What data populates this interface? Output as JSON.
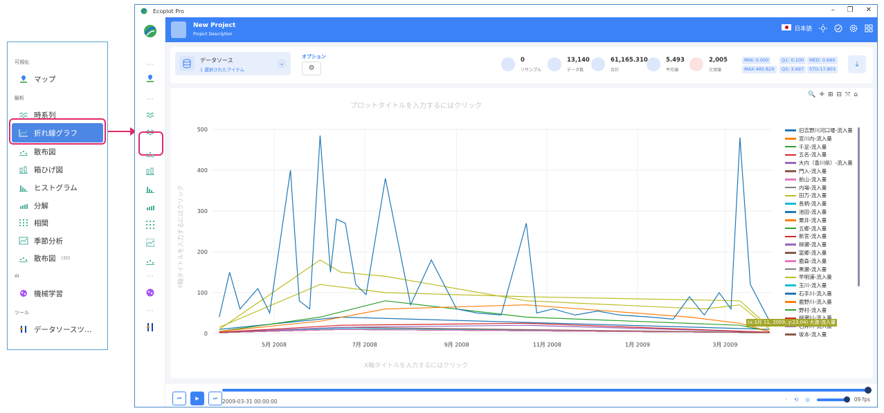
{
  "annotation_panel": {
    "sections": [
      {
        "label": "可視化",
        "items": [
          {
            "label": "マップ",
            "icon": "map-pin-icon"
          }
        ]
      },
      {
        "label": "解析",
        "items": [
          {
            "label": "時系列",
            "icon": "timeseries-icon"
          },
          {
            "label": "折れ線グラフ",
            "icon": "line-chart-icon",
            "selected": true
          },
          {
            "label": "散布図",
            "icon": "scatter-icon"
          },
          {
            "label": "箱ひげ図",
            "icon": "boxplot-icon"
          },
          {
            "label": "ヒストグラム",
            "icon": "histogram-icon"
          },
          {
            "label": "分解",
            "icon": "decompose-icon"
          },
          {
            "label": "相関",
            "icon": "correlation-icon"
          },
          {
            "label": "季節分析",
            "icon": "seasonal-icon"
          },
          {
            "label": "散布図",
            "icon": "scatter3d-icon",
            "sub": "(3D)"
          }
        ]
      },
      {
        "label": "AI",
        "items": [
          {
            "label": "機械学習",
            "icon": "ml-icon"
          }
        ]
      },
      {
        "label": "ツール",
        "items": [
          {
            "label": "データソースツ…",
            "icon": "tools-icon"
          }
        ]
      }
    ]
  },
  "window": {
    "title": "Ecoplot Pro",
    "controls": [
      "–",
      "❐",
      "✕"
    ]
  },
  "header": {
    "project_name": "New Project",
    "project_desc": "Project Description",
    "language": "日本語"
  },
  "toolbar": {
    "datasource_title": "データソース",
    "datasource_sub": "1 選択されたアイテム",
    "options_label": "オプション",
    "stats": [
      {
        "value": "0",
        "label": "リサンプル"
      },
      {
        "value": "13,140",
        "label": "データ数"
      },
      {
        "value": "61,165.310",
        "label": "合計"
      },
      {
        "value": "5.493",
        "label": "平均値"
      },
      {
        "value": "2,005",
        "label": "欠測値"
      }
    ],
    "quartiles": {
      "min": "MIN:   0.000",
      "q1": "Q1:  0.100",
      "med": "MED:  0.660",
      "max": "MAX:485.820",
      "q3": "Q3:  3.697",
      "std": "STD:17.803"
    }
  },
  "chart": {
    "plot_title": "プロットタイトルを入力するにはクリック",
    "x_title": "X軸タイトルを入力するにはクリック",
    "y_title": "Y軸タイトルを入力するにはクリック",
    "tooltip": "(x:3月 11, 2009, y:23.04)",
    "tooltip_series": "大渡-流入量"
  },
  "chart_data": {
    "type": "line",
    "xlabel": "",
    "ylabel": "",
    "ylim": [
      0,
      500
    ],
    "yticks": [
      "0",
      "100",
      "200",
      "300",
      "400",
      "500"
    ],
    "xticks": [
      "5月 2008",
      "7月 2008",
      "9月 2008",
      "11月 2008",
      "1月 2009",
      "3月 2009"
    ],
    "xrange": [
      "2008-03-20",
      "2009-04-02"
    ],
    "grid": true,
    "legend_position": "right",
    "series": [
      {
        "name": "旧吉野川河口堰-流入量",
        "color": "#1f77b4",
        "x": [
          "2008-03-25",
          "2008-04-01",
          "2008-04-08",
          "2008-04-20",
          "2008-04-28",
          "2008-05-12",
          "2008-05-18",
          "2008-05-25",
          "2008-06-01",
          "2008-06-08",
          "2008-06-12",
          "2008-06-18",
          "2008-06-25",
          "2008-07-02",
          "2008-07-15",
          "2008-08-01",
          "2008-08-15",
          "2008-09-01",
          "2008-09-15",
          "2008-10-01",
          "2008-10-18",
          "2008-10-25",
          "2008-11-05",
          "2008-11-20",
          "2008-12-05",
          "2008-12-20",
          "2009-01-10",
          "2009-01-25",
          "2009-02-05",
          "2009-02-15",
          "2009-02-25",
          "2009-03-05",
          "2009-03-11",
          "2009-03-18",
          "2009-03-31"
        ],
        "y": [
          40,
          150,
          60,
          110,
          50,
          400,
          80,
          60,
          485,
          150,
          280,
          270,
          120,
          95,
          380,
          70,
          180,
          60,
          50,
          45,
          270,
          50,
          60,
          45,
          55,
          45,
          40,
          35,
          90,
          45,
          100,
          60,
          480,
          120,
          30
        ]
      },
      {
        "name": "宮川内-流入量",
        "color": "#ff7f0e",
        "x": [
          "2008-03-25",
          "2008-06-01",
          "2008-07-15",
          "2008-10-18",
          "2009-02-05",
          "2009-03-11",
          "2009-03-31"
        ],
        "y": [
          5,
          30,
          60,
          70,
          40,
          25,
          5
        ]
      },
      {
        "name": "千足-流入量",
        "color": "#2ca02c",
        "x": [
          "2008-03-25",
          "2008-06-01",
          "2008-07-15",
          "2008-10-18",
          "2009-03-11",
          "2009-03-31"
        ],
        "y": [
          5,
          40,
          80,
          40,
          20,
          5
        ]
      },
      {
        "name": "五名-流入量",
        "color": "#d62728",
        "x": [
          "2008-03-25",
          "2008-06-15",
          "2008-10-18",
          "2009-03-31"
        ],
        "y": [
          3,
          20,
          25,
          3
        ]
      },
      {
        "name": "大内（香川県）-流入量",
        "color": "#9467bd",
        "x": [
          "2008-03-25",
          "2008-06-15",
          "2008-10-18",
          "2009-03-31"
        ],
        "y": [
          3,
          15,
          20,
          3
        ]
      },
      {
        "name": "門入-流入量",
        "color": "#8c564b",
        "x": [
          "2008-03-25",
          "2008-06-15",
          "2009-03-31"
        ],
        "y": [
          2,
          15,
          2
        ]
      },
      {
        "name": "前山-流入量",
        "color": "#e377c2",
        "x": [
          "2008-03-25",
          "2008-06-15",
          "2009-03-31"
        ],
        "y": [
          2,
          10,
          2
        ]
      },
      {
        "name": "内場-流入量",
        "color": "#7f7f7f",
        "x": [
          "2008-03-25",
          "2008-06-15",
          "2009-03-31"
        ],
        "y": [
          2,
          10,
          2
        ]
      },
      {
        "name": "田万-流入量",
        "color": "#bcbd22",
        "x": [
          "2008-03-25",
          "2008-06-01",
          "2008-06-15",
          "2008-07-15",
          "2008-10-18",
          "2009-02-15",
          "2009-03-11",
          "2009-03-31"
        ],
        "y": [
          10,
          180,
          150,
          140,
          80,
          60,
          70,
          10
        ]
      },
      {
        "name": "長柄-流入量",
        "color": "#17becf",
        "x": [
          "2008-03-25",
          "2008-06-15",
          "2009-03-31"
        ],
        "y": [
          2,
          12,
          2
        ]
      },
      {
        "name": "池田-流入量",
        "color": "#1f77b4",
        "x": [
          "2008-03-25",
          "2008-06-15",
          "2009-03-31"
        ],
        "y": [
          10,
          40,
          10
        ]
      },
      {
        "name": "粟井-流入量",
        "color": "#ff7f0e",
        "x": [
          "2008-03-25",
          "2008-06-15",
          "2009-03-31"
        ],
        "y": [
          2,
          10,
          2
        ]
      },
      {
        "name": "五郷-流入量",
        "color": "#2ca02c",
        "x": [
          "2008-03-25",
          "2008-06-15",
          "2009-03-31"
        ],
        "y": [
          2,
          10,
          2
        ]
      },
      {
        "name": "新宮-流入量",
        "color": "#d62728",
        "x": [
          "2008-03-25",
          "2008-06-15",
          "2009-03-31"
        ],
        "y": [
          2,
          10,
          2
        ]
      },
      {
        "name": "柳瀬-流入量",
        "color": "#9467bd",
        "x": [
          "2008-03-25",
          "2008-06-15",
          "2009-03-31"
        ],
        "y": [
          2,
          10,
          2
        ]
      },
      {
        "name": "富郷-流入量",
        "color": "#8c564b",
        "x": [
          "2008-03-25",
          "2008-06-15",
          "2009-03-31"
        ],
        "y": [
          2,
          10,
          2
        ]
      },
      {
        "name": "鹿森-流入量",
        "color": "#e377c2",
        "x": [
          "2008-03-25",
          "2008-06-15",
          "2009-03-31"
        ],
        "y": [
          2,
          10,
          2
        ]
      },
      {
        "name": "黒瀬-流入量",
        "color": "#7f7f7f",
        "x": [
          "2008-03-25",
          "2008-06-15",
          "2009-03-31"
        ],
        "y": [
          2,
          10,
          2
        ]
      },
      {
        "name": "早明浦-流入量",
        "color": "#bcbd22",
        "x": [
          "2008-03-25",
          "2008-06-01",
          "2008-07-15",
          "2008-10-18",
          "2009-03-11",
          "2009-03-31"
        ],
        "y": [
          15,
          120,
          100,
          90,
          80,
          15
        ]
      },
      {
        "name": "玉川-流入量",
        "color": "#17becf",
        "x": [
          "2008-03-25",
          "2008-06-15",
          "2009-03-31"
        ],
        "y": [
          2,
          10,
          2
        ]
      },
      {
        "name": "石手川-流入量",
        "color": "#1f77b4",
        "x": [
          "2008-03-25",
          "2008-06-15",
          "2009-03-31"
        ],
        "y": [
          2,
          10,
          2
        ]
      },
      {
        "name": "鹿野川-流入量",
        "color": "#ff7f0e",
        "x": [
          "2008-03-25",
          "2008-06-15",
          "2009-03-31"
        ],
        "y": [
          2,
          10,
          2
        ]
      },
      {
        "name": "野村-流入量",
        "color": "#2ca02c",
        "x": [
          "2008-03-25",
          "2008-06-15",
          "2009-03-31"
        ],
        "y": [
          2,
          10,
          2
        ]
      },
      {
        "name": "柳瀬川-流入量",
        "color": "#d62728",
        "x": [
          "2008-03-25",
          "2008-06-15",
          "2009-03-31"
        ],
        "y": [
          2,
          10,
          2
        ]
      },
      {
        "name": "石井川-流入量",
        "color": "#9467bd",
        "x": [
          "2008-03-25",
          "2008-06-15",
          "2009-03-31"
        ],
        "y": [
          2,
          10,
          2
        ]
      },
      {
        "name": "坂本-流入量",
        "color": "#8c564b",
        "x": [
          "2008-03-25",
          "2008-06-15",
          "2009-03-31"
        ],
        "y": [
          2,
          10,
          2
        ]
      }
    ]
  },
  "player": {
    "time": "2009-03-31 00:00:00",
    "fps": "09 fps"
  }
}
